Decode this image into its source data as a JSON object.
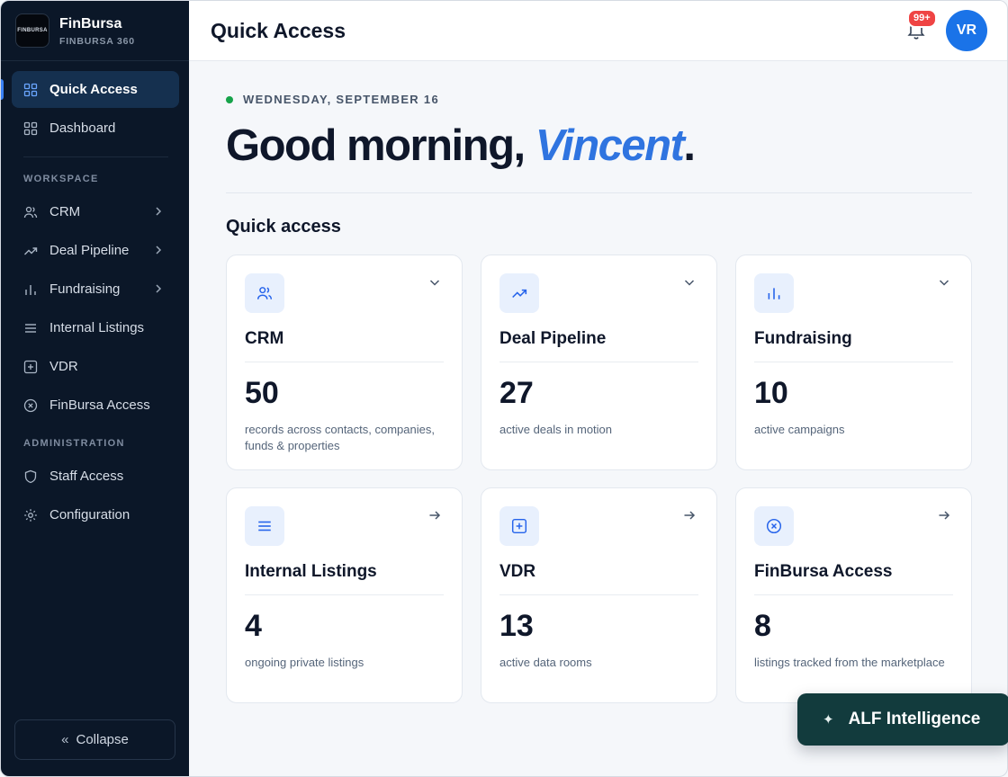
{
  "brand": {
    "logo_text": "FINBURSA",
    "name": "FinBursa",
    "subtitle": "FINBURSA 360"
  },
  "sidebar": {
    "top_items": [
      {
        "label": "Quick Access",
        "icon": "grid-icon",
        "active": true
      },
      {
        "label": "Dashboard",
        "icon": "grid-icon",
        "active": false
      }
    ],
    "workspace_label": "WORKSPACE",
    "workspace_items": [
      {
        "label": "CRM",
        "icon": "users-icon",
        "has_children": true
      },
      {
        "label": "Deal Pipeline",
        "icon": "trend-up-icon",
        "has_children": true
      },
      {
        "label": "Fundraising",
        "icon": "bar-chart-icon",
        "has_children": true
      },
      {
        "label": "Internal Listings",
        "icon": "list-icon",
        "has_children": false
      },
      {
        "label": "VDR",
        "icon": "plus-square-icon",
        "has_children": false
      },
      {
        "label": "FinBursa Access",
        "icon": "circle-x-icon",
        "has_children": false
      }
    ],
    "admin_label": "ADMINISTRATION",
    "admin_items": [
      {
        "label": "Staff Access",
        "icon": "shield-icon"
      },
      {
        "label": "Configuration",
        "icon": "gear-icon"
      }
    ],
    "collapse_label": "Collapse"
  },
  "header": {
    "title": "Quick Access",
    "notification_badge": "99+",
    "avatar_initials": "VR"
  },
  "main": {
    "date": "WEDNESDAY, SEPTEMBER 16",
    "greeting_prefix": "Good morning, ",
    "greeting_name": "Vincent",
    "greeting_suffix": ".",
    "section_title": "Quick access",
    "cards": [
      {
        "title": "CRM",
        "value": "50",
        "description": "records across contacts, companies, funds & properties",
        "icon": "users-icon",
        "action": "chevron-down-icon"
      },
      {
        "title": "Deal Pipeline",
        "value": "27",
        "description": "active deals in motion",
        "icon": "trend-up-icon",
        "action": "chevron-down-icon"
      },
      {
        "title": "Fundraising",
        "value": "10",
        "description": "active campaigns",
        "icon": "bar-chart-icon",
        "action": "chevron-down-icon"
      },
      {
        "title": "Internal Listings",
        "value": "4",
        "description": "ongoing private listings",
        "icon": "list-icon",
        "action": "arrow-right-icon"
      },
      {
        "title": "VDR",
        "value": "13",
        "description": "active data rooms",
        "icon": "plus-square-icon",
        "action": "arrow-right-icon"
      },
      {
        "title": "FinBursa Access",
        "value": "8",
        "description": "listings tracked from the marketplace",
        "icon": "circle-x-icon",
        "action": "arrow-right-icon"
      }
    ]
  },
  "assistant": {
    "label": "ALF Intelligence",
    "icon": "sparkle-icon"
  },
  "colors": {
    "sidebar_bg": "#0b1728",
    "accent": "#2f74e0",
    "badge": "#ef4444",
    "status_dot": "#16a34a",
    "assistant_bg": "#123b3d"
  }
}
